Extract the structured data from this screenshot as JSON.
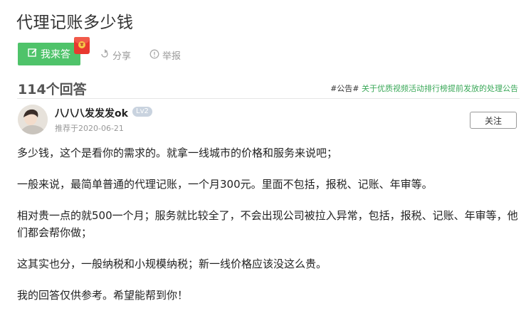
{
  "question": {
    "title": "代理记账多少钱"
  },
  "actions": {
    "answer_label": "我来答",
    "share_label": "分享",
    "report_label": "举报"
  },
  "answers": {
    "count_label": "114个回答",
    "notice_tag": "#公告#",
    "notice_link": "关于优质视频活动排行榜提前发放的处理公告"
  },
  "answer": {
    "username": "八八八发发发ok",
    "level": "Lv2",
    "meta": "推荐于2020-06-21",
    "follow_label": "关注",
    "paragraphs": [
      "多少钱，这个是看你的需求的。就拿一线城市的价格和服务来说吧；",
      "一般来说，最简单普通的代理记账，一个月300元。里面不包括，报税、记账、年审等。",
      "相对贵一点的就500一个月；服务就比较全了，不会出现公司被拉入异常，包括，报税、记账、年审等，他们都会帮你做；",
      "这其实也分，一般纳税和小规模纳税；新一线价格应该没这么贵。",
      "我的回答仅供参考。希望能帮到你！"
    ]
  },
  "colors": {
    "accent": "#4fc36a",
    "link": "#3aa858"
  }
}
